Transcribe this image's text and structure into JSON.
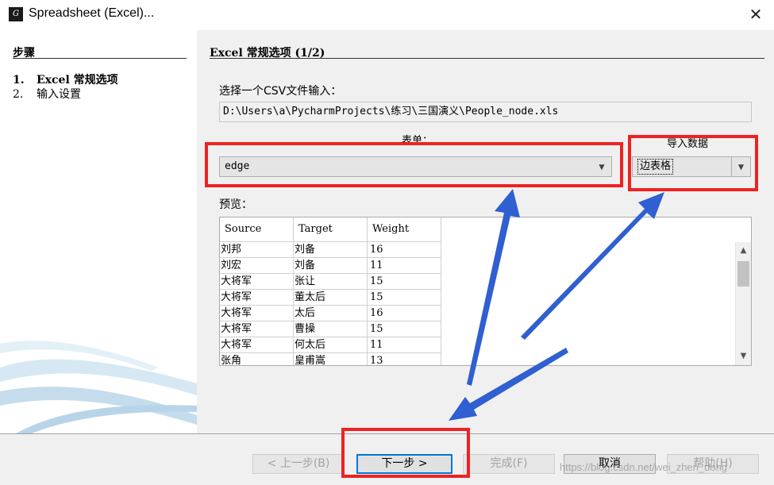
{
  "window": {
    "title": "Spreadsheet (Excel)...",
    "close_symbol": "✕"
  },
  "steps": {
    "header": "步骤",
    "items": [
      {
        "num": "1.",
        "label": "Excel 常规选项",
        "active": true
      },
      {
        "num": "2.",
        "label": "输入设置",
        "active": false
      }
    ]
  },
  "main": {
    "title": "Excel 常规选项 (1/2)",
    "csv_label": "选择一个CSV文件输入：",
    "file_path": "D:\\Users\\a\\PycharmProjects\\练习\\三国演义\\People_node.xls",
    "sheet_label": "表单：",
    "sheet_value": "edge",
    "import_label": "导入数据",
    "import_value": "边表格",
    "preview_label": "预览：",
    "table": {
      "columns": [
        "Source",
        "Target",
        "Weight"
      ],
      "rows": [
        [
          "刘邦",
          "刘备",
          "16"
        ],
        [
          "刘宏",
          "刘备",
          "11"
        ],
        [
          "大将军",
          "张让",
          "15"
        ],
        [
          "大将军",
          "董太后",
          "15"
        ],
        [
          "大将军",
          "太后",
          "16"
        ],
        [
          "大将军",
          "曹操",
          "15"
        ],
        [
          "大将军",
          "何太后",
          "11"
        ],
        [
          "张角",
          "皇甫嵩",
          "13"
        ]
      ]
    }
  },
  "buttons": {
    "prev": "< 上一步(B)",
    "next": "下一步 >",
    "finish": "完成(F)",
    "cancel": "取消",
    "help": "帮助(H)"
  },
  "watermark": "https://blog.csdn.net/wei_zhen_dong",
  "colors": {
    "annotation_red": "#ee2222",
    "annotation_blue": "#2f5fd0",
    "focus_blue": "#0078d7"
  }
}
